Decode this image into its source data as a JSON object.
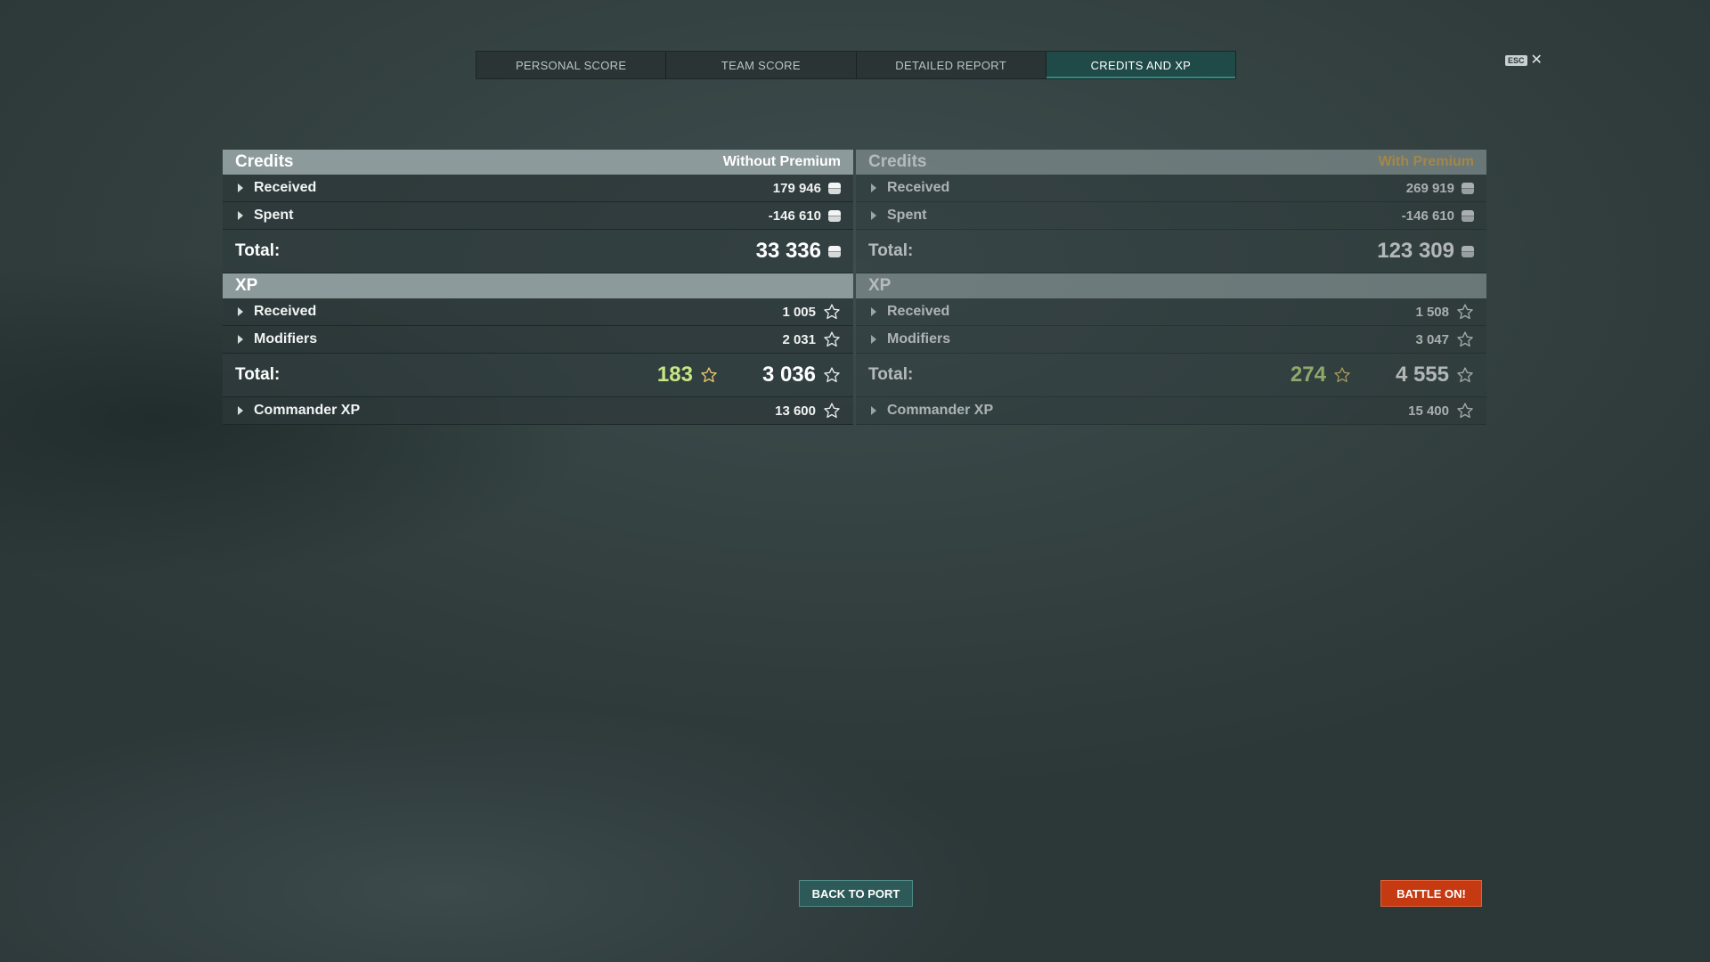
{
  "tabs": [
    {
      "label": "PERSONAL SCORE"
    },
    {
      "label": "TEAM SCORE"
    },
    {
      "label": "DETAILED REPORT"
    },
    {
      "label": "CREDITS AND XP",
      "active": true
    }
  ],
  "esc": {
    "key": "ESC",
    "close": "✕"
  },
  "without_premium": {
    "credits_header": "Credits",
    "premium_label": "Without Premium",
    "credits_received_label": "Received",
    "credits_received": "179 946",
    "credits_spent_label": "Spent",
    "credits_spent": "-146 610",
    "credits_total_label": "Total:",
    "credits_total": "33 336",
    "xp_header": "XP",
    "xp_received_label": "Received",
    "xp_received": "1 005",
    "xp_modifiers_label": "Modifiers",
    "xp_modifiers": "2 031",
    "xp_total_label": "Total:",
    "xp_total_free": "183",
    "xp_total": "3 036",
    "commander_xp_label": "Commander XP",
    "commander_xp": "13 600"
  },
  "with_premium": {
    "credits_header": "Credits",
    "premium_label": "With Premium",
    "credits_received_label": "Received",
    "credits_received": "269 919",
    "credits_spent_label": "Spent",
    "credits_spent": "-146 610",
    "credits_total_label": "Total:",
    "credits_total": "123 309",
    "xp_header": "XP",
    "xp_received_label": "Received",
    "xp_received": "1 508",
    "xp_modifiers_label": "Modifiers",
    "xp_modifiers": "3 047",
    "xp_total_label": "Total:",
    "xp_total_free": "274",
    "xp_total": "4 555",
    "commander_xp_label": "Commander XP",
    "commander_xp": "15 400"
  },
  "buttons": {
    "back_to_port": "BACK TO PORT",
    "battle_on": "BATTLE ON!"
  },
  "colors": {
    "accent_tab": "#1f4a48",
    "premium_gold": "#e8b24a",
    "free_xp_green": "#c6e685",
    "battle_button": "#c63a12"
  },
  "icons": {
    "credits": "credits-coin-icon",
    "xp": "xp-star-icon",
    "expand": "caret-right-icon"
  }
}
